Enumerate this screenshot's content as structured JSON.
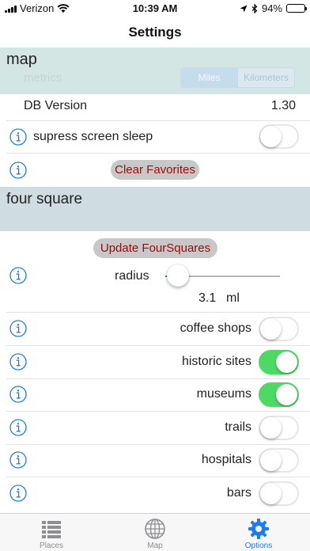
{
  "status_bar": {
    "carrier": "Verizon",
    "time": "10:39 AM",
    "battery": "94%",
    "battery_level": 0.94
  },
  "nav": {
    "title": "Settings"
  },
  "map_section": {
    "title": "map",
    "metrics_label": "metrics",
    "segments": [
      "Miles",
      "Kilometers"
    ],
    "selected_segment": "Miles"
  },
  "db_version": {
    "label": "DB Version",
    "value": "1.30"
  },
  "screen_sleep": {
    "label": "supress screen sleep",
    "on": false
  },
  "clear_favorites": {
    "label": "Clear Favorites"
  },
  "foursquare_section": {
    "title": "four square"
  },
  "update_button": {
    "label": "Update FourSquares"
  },
  "radius": {
    "label": "radius",
    "value": "3.1",
    "unit": "ml",
    "slider_fraction": 0.02
  },
  "categories": [
    {
      "label": "coffee shops",
      "on": false
    },
    {
      "label": "historic sites",
      "on": true
    },
    {
      "label": "museums",
      "on": true
    },
    {
      "label": "trails",
      "on": false
    },
    {
      "label": "hospitals",
      "on": false
    },
    {
      "label": "bars",
      "on": false
    }
  ],
  "tab_bar": {
    "tabs": [
      {
        "label": "Places",
        "icon": "list-icon"
      },
      {
        "label": "Map",
        "icon": "globe-icon"
      },
      {
        "label": "Options",
        "icon": "gear-icon"
      }
    ],
    "active": "Options"
  },
  "colors": {
    "accent": "#1a7cf0",
    "toggle_on": "#4cd964",
    "button_text": "#9b0b0b",
    "map_header_bg": "#d4e6e4",
    "foursquare_header_bg": "#cfdde3"
  }
}
